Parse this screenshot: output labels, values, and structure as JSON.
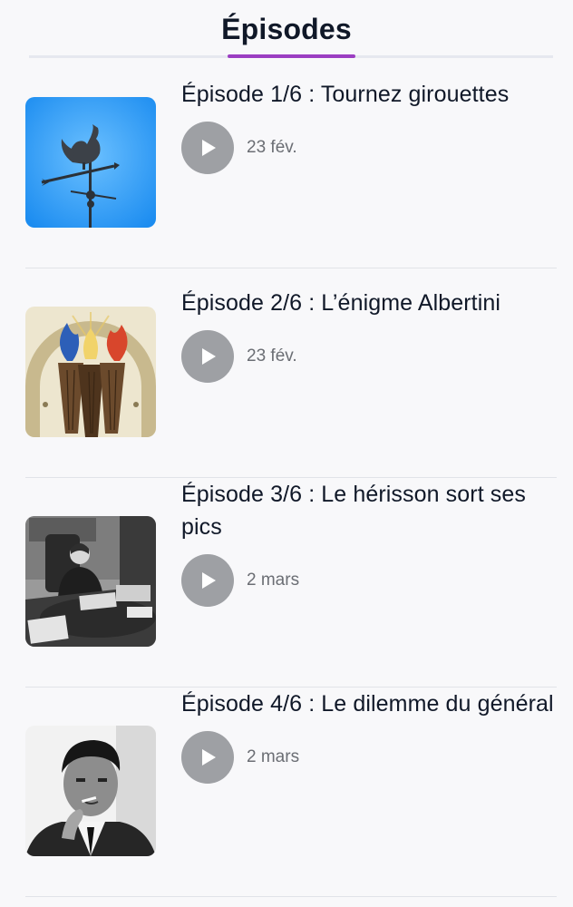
{
  "header": {
    "tab_label": "Épisodes",
    "accent_color": "#9b3ec2"
  },
  "episodes": [
    {
      "title": "Épisode 1/6 : Tournez girouettes",
      "date": "23 fév.",
      "thumbnail_icon": "weathervane-rooster-image"
    },
    {
      "title": "Épisode 2/6 : L’énigme Albertini",
      "date": "23 fév.",
      "thumbnail_icon": "torch-flames-poster-image"
    },
    {
      "title": "Épisode 3/6 : Le hérisson sort ses pics",
      "date": "2 mars",
      "thumbnail_icon": "woman-at-desk-photo"
    },
    {
      "title": "Épisode 4/6 : Le dilemme du général",
      "date": "2 mars",
      "thumbnail_icon": "man-smoking-portrait-photo"
    }
  ],
  "play_icon": "play-icon"
}
